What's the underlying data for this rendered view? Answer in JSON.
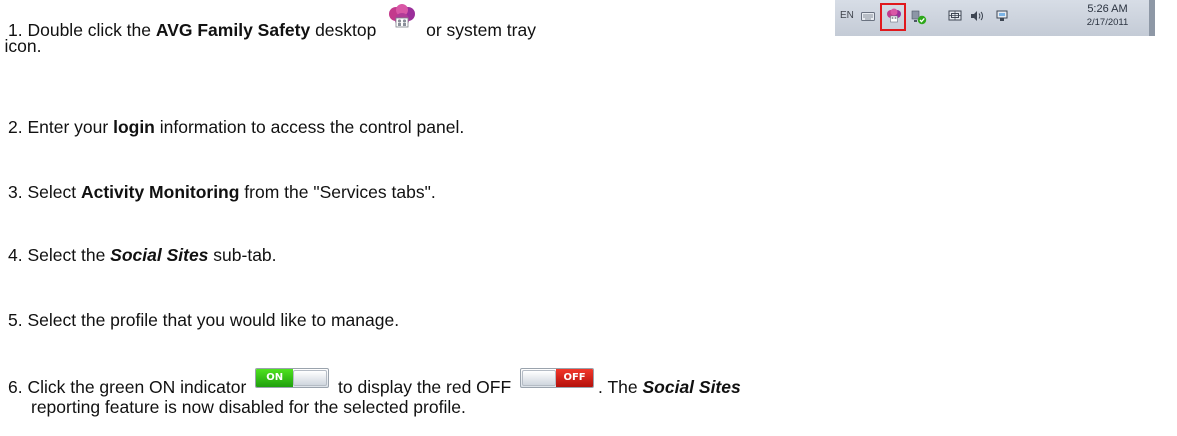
{
  "step1": {
    "num": "1. ",
    "pre": "Double click the ",
    "bold": "AVG Family Safety",
    "mid": " desktop ",
    "post": " or system tray",
    "cont": "icon."
  },
  "tray": {
    "lang": "EN",
    "time": "5:26 AM",
    "date": "2/17/2011",
    "icons": [
      "keyboard-icon",
      "avg-family-safety-icon",
      "network-shield-icon",
      "display-icon",
      "speaker-icon",
      "power-icon"
    ]
  },
  "step2": {
    "num": "2. ",
    "pre": "Enter your ",
    "bold": "login",
    "post": " information to access the control panel."
  },
  "step3": {
    "num": "3. ",
    "pre": "Select ",
    "bold": "Activity Monitoring",
    "post": " from the \"Services tabs\"."
  },
  "step4": {
    "num": "4. ",
    "pre": "Select the ",
    "bolditalic": "Social Sites",
    "post": " sub-tab."
  },
  "step5": {
    "num": "5. ",
    "text": "Select the profile that you would like to manage."
  },
  "step6": {
    "num": "6. ",
    "pre": "Click the green ON indicator ",
    "on_label": "ON",
    "mid": " to display the red OFF ",
    "off_label": "OFF",
    "post_pre": ". The ",
    "bolditalic": "Social Sites",
    "cont": "reporting feature is now disabled for the selected profile."
  },
  "colors": {
    "highlight": "#e0181c",
    "on_green": "#2fbf16",
    "off_red": "#d61e16"
  }
}
